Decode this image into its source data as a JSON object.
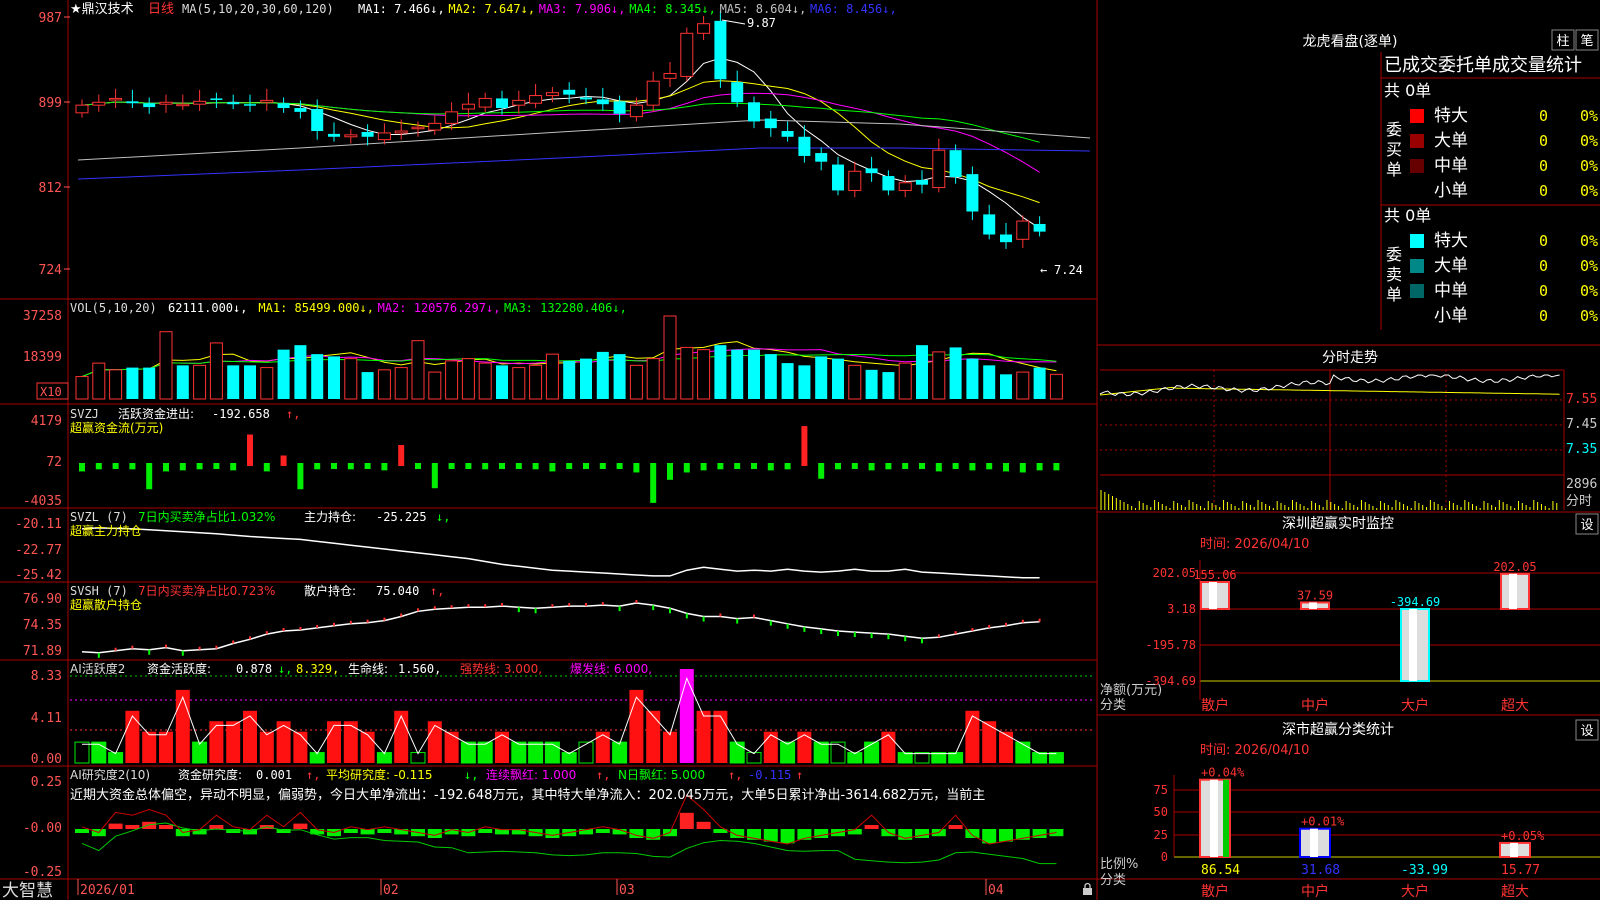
{
  "app": {
    "brand": "大智慧"
  },
  "main": {
    "stock_name": "★鼎汉技术",
    "period": "日线",
    "ma_header": "MA(5,10,20,30,60,120)",
    "ma_values": [
      {
        "label": "MA1:",
        "value": "7.466",
        "arrow": "↓",
        "color": "#ffffff"
      },
      {
        "label": "MA2:",
        "value": "7.647",
        "arrow": "↓",
        "color": "#ffff00"
      },
      {
        "label": "MA3:",
        "value": "7.906",
        "arrow": "↓",
        "color": "#ff00ff"
      },
      {
        "label": "MA4:",
        "value": "8.345",
        "arrow": "↓",
        "color": "#00ff00"
      },
      {
        "label": "MA5:",
        "value": "8.604",
        "arrow": "↓",
        "color": "#c0c0c0"
      },
      {
        "label": "MA6:",
        "value": "8.456",
        "arrow": "↓",
        "color": "#3333ff"
      }
    ],
    "y_ticks": [
      "987",
      "899",
      "812",
      "724"
    ],
    "high_label": "9.87",
    "low_label": "7.24"
  },
  "vol": {
    "header": "VOL(5,10,20)",
    "values": [
      {
        "label": "",
        "value": "62111.000",
        "arrow": "↓",
        "color": "#ffffff"
      },
      {
        "label": "MA1:",
        "value": "85499.000",
        "arrow": "↓",
        "color": "#ffff00"
      },
      {
        "label": "MA2:",
        "value": "120576.297",
        "arrow": "↓",
        "color": "#ff00ff"
      },
      {
        "label": "MA3:",
        "value": "132280.406",
        "arrow": "↓",
        "color": "#00ff00"
      }
    ],
    "y_ticks": [
      "37258",
      "18399"
    ],
    "unit": "X10"
  },
  "svzj": {
    "header": "SVZJ",
    "line1_label": "活跃资金进出:",
    "line1_value": "-192.658",
    "line1_arrow": "↑,",
    "line2": "超赢资金流(万元)",
    "y_ticks": [
      "4179",
      "72",
      "-4035"
    ]
  },
  "svzl": {
    "header": "SVZL (7)",
    "highlight": "7日内买卖净占比1.032%",
    "label": "主力持仓:",
    "value": "-25.225",
    "arrow": "↓,",
    "line2": "超赢主力持仓",
    "y_ticks": [
      "-20.11",
      "-22.77",
      "-25.42"
    ]
  },
  "svsh": {
    "header": "SVSH (7)",
    "highlight": "7日内买卖净占比0.723%",
    "label": "散户持仓:",
    "value": "75.040",
    "arrow": "↑,",
    "line2": "超赢散户持仓",
    "y_ticks": [
      "76.90",
      "74.35",
      "71.89"
    ]
  },
  "ai_active": {
    "header": "AI活跃度2",
    "label": "资金活跃度:",
    "value": "0.878",
    "arrow": "↓,",
    "v2": "8.329,",
    "life_label": "生命线:",
    "life_value": "1.560,",
    "strong": "强势线: 3.000,",
    "burst": "爆发线: 6.000,",
    "y_ticks": [
      "8.33",
      "4.11",
      "0.00"
    ]
  },
  "ai_research": {
    "header": "AI研究度2(10)",
    "label": "资金研究度:",
    "value": "0.001",
    "arrow": "↑,",
    "avg": "平均研究度: -0.115",
    "avg_arrow": "↓,",
    "cont": "连续飘红: 1.000",
    "cont_arrow": "↑,",
    "n": "N日飘红: 5.000",
    "n_arrow": "↑,",
    "last": "-0.115",
    "last_arrow": "↑",
    "summary": "近期大资金总体偏空，异动不明显，偏弱势，今日大单净流出：-192.648万元，其中特大单净流入：202.045万元，大单5日累计净出-3614.682万元，当前主",
    "y_ticks": [
      "0.25",
      "-0.00",
      "-0.25"
    ]
  },
  "x_axis": [
    "2026/01",
    "02",
    "03",
    "04"
  ],
  "right": {
    "title": "龙虎看盘(逐单)",
    "btn1": "柱",
    "btn2": "笔",
    "stat_title": "已成交委托单成交量统计",
    "buy": {
      "vlabel": "委买单",
      "total": "共 0单",
      "rows": [
        {
          "name": "特大",
          "qty": "0",
          "pct": "0%",
          "color": "#ff0000"
        },
        {
          "name": "大单",
          "qty": "0",
          "pct": "0%",
          "color": "#990000"
        },
        {
          "name": "中单",
          "qty": "0",
          "pct": "0%",
          "color": "#660000"
        },
        {
          "name": "小单",
          "qty": "0",
          "pct": "0%",
          "color": ""
        }
      ]
    },
    "sell": {
      "vlabel": "委卖单",
      "total": "共 0单",
      "rows": [
        {
          "name": "特大",
          "qty": "0",
          "pct": "0%",
          "color": "#00ffff"
        },
        {
          "name": "大单",
          "qty": "0",
          "pct": "0%",
          "color": "#008888"
        },
        {
          "name": "中单",
          "qty": "0",
          "pct": "0%",
          "color": "#006666"
        },
        {
          "name": "小单",
          "qty": "0",
          "pct": "0%",
          "color": ""
        }
      ]
    },
    "intraday_title": "分时走势",
    "intraday_y": [
      "7.55",
      "7.45",
      "7.35"
    ],
    "intraday_vol": "2896",
    "intraday_unit": "分时",
    "sz_title": "深圳超赢实时监控",
    "sz_btn": "设",
    "sz_time": "时间: 2026/04/10",
    "sz_y": [
      "202.05",
      "3.18",
      "-195.78",
      "-394.69"
    ],
    "sz_ylabel": "净额(万元)",
    "sz_xlabel": "分类",
    "sz_cats": [
      "散户",
      "中户",
      "大户",
      "超大"
    ],
    "sz_vals": [
      "155.06",
      "37.59",
      "-394.69",
      "202.05"
    ],
    "ss_title": "深市超赢分类统计",
    "ss_btn": "设",
    "ss_time": "时间: 2026/04/10",
    "ss_y": [
      "75",
      "50",
      "25",
      "0"
    ],
    "ss_ylabel": "比例%",
    "ss_xlabel": "分类",
    "ss_cats": [
      "散户",
      "中户",
      "大户",
      "超大"
    ],
    "ss_top": [
      "+0.04%",
      "+0.01%",
      "",
      "+0.05%"
    ],
    "ss_vals": [
      "86.54",
      "31.68",
      "-33.99",
      "15.77"
    ]
  },
  "chart_data": [
    {
      "type": "candlestick",
      "title": "★鼎汉技术 日线",
      "y_range": [
        7.24,
        9.87
      ],
      "high": 9.87,
      "low": 7.24,
      "close_series": [
        8.95,
        8.98,
        9.02,
        8.97,
        8.93,
        8.98,
        8.96,
        8.99,
        9.01,
        8.96,
        8.95,
        9.0,
        8.92,
        8.88,
        8.68,
        8.62,
        8.64,
        8.62,
        8.66,
        8.68,
        8.72,
        8.76,
        8.88,
        8.96,
        9.02,
        8.92,
        9.0,
        9.05,
        9.08,
        9.06,
        9.01,
        8.96,
        8.86,
        8.95,
        9.2,
        9.28,
        9.7,
        9.8,
        9.22,
        8.98,
        8.78,
        8.71,
        8.62,
        8.42,
        8.36,
        8.06,
        8.26,
        8.24,
        8.06,
        8.14,
        8.12,
        8.48,
        8.2,
        7.84,
        7.6,
        7.52,
        7.74,
        7.63
      ]
    },
    {
      "type": "bar",
      "title": "VOL(5,10,20)",
      "y_ticks": [
        37258,
        18399
      ],
      "unit": "X10",
      "values": [
        10,
        16,
        13,
        14,
        14,
        30,
        15,
        15,
        25,
        15,
        15,
        14,
        22,
        24,
        20,
        19,
        18,
        12,
        13,
        14,
        26,
        12,
        17,
        18,
        16,
        15,
        14,
        15,
        20,
        17,
        18,
        21,
        20,
        15,
        18,
        37,
        23,
        22,
        24,
        22,
        22,
        20,
        16,
        15,
        19,
        18,
        15,
        13,
        12,
        16,
        24,
        21,
        23,
        18,
        15,
        11,
        12,
        14,
        11
      ]
    },
    {
      "type": "bar",
      "title": "SVZJ 超赢资金流(万元)",
      "y_ticks": [
        4179,
        72,
        -4035
      ],
      "values": [
        -800,
        -600,
        -500,
        -600,
        -2500,
        -800,
        -700,
        -600,
        -500,
        -700,
        3000,
        -800,
        1000,
        -2500,
        -600,
        -500,
        -600,
        -400,
        -700,
        2000,
        -300,
        -2400,
        -300,
        -500,
        -600,
        -400,
        -500,
        -600,
        -800,
        -200,
        -300,
        -300,
        -400,
        -900,
        -3800,
        -1600,
        -900,
        -700,
        -600,
        -500,
        -400,
        -700,
        -600,
        3800,
        -1500,
        -600,
        -500,
        -700,
        -600,
        -400,
        -500,
        -800,
        -400,
        -700,
        -600,
        -800,
        -900,
        -700,
        -700
      ]
    },
    {
      "type": "line",
      "title": "SVZL 超赢主力持仓",
      "y_ticks": [
        -20.11,
        -22.77,
        -25.42
      ],
      "values": [
        -20.2,
        -20.1,
        -20.15,
        -20.2,
        -20.3,
        -20.4,
        -20.5,
        -20.6,
        -20.7,
        -20.85,
        -21.0,
        -21.1,
        -21.2,
        -21.3,
        -21.5,
        -21.7,
        -21.9,
        -22.1,
        -22.3,
        -22.5,
        -22.7,
        -22.9,
        -23.1,
        -23.3,
        -23.6,
        -23.9,
        -24.1,
        -24.3,
        -24.5,
        -24.6,
        -24.7,
        -24.8,
        -24.9,
        -25.0,
        -25.1,
        -25.1,
        -24.5,
        -24.2,
        -24.4,
        -24.6,
        -24.5,
        -24.6,
        -24.4,
        -24.6,
        -24.7,
        -24.6,
        -24.4,
        -24.6,
        -24.6,
        -24.4,
        -24.7,
        -24.8,
        -24.9,
        -25.0,
        -25.1,
        -25.2,
        -25.3,
        -25.3
      ]
    },
    {
      "type": "line",
      "title": "SVSH 超赢散户持仓",
      "y_ticks": [
        76.9,
        74.35,
        71.89
      ],
      "values": [
        72.2,
        72.1,
        72.3,
        72.5,
        72.4,
        72.6,
        72.3,
        72.4,
        72.5,
        73.0,
        73.4,
        73.9,
        74.2,
        74.3,
        74.5,
        74.7,
        74.9,
        75.0,
        75.2,
        75.6,
        76.1,
        76.3,
        76.4,
        76.5,
        76.5,
        76.6,
        76.5,
        76.4,
        76.5,
        76.6,
        76.6,
        76.7,
        76.6,
        76.9,
        76.7,
        76.4,
        75.9,
        75.6,
        75.6,
        75.4,
        75.5,
        75.2,
        74.9,
        74.6,
        74.4,
        74.2,
        74.1,
        74.0,
        73.9,
        73.7,
        73.5,
        73.6,
        73.9,
        74.2,
        74.5,
        74.7,
        75.0,
        75.1
      ]
    },
    {
      "type": "bar",
      "title": "AI活跃度2",
      "y_ticks": [
        8.33,
        4.11,
        0.0
      ],
      "thresholds": {
        "life": 1.56,
        "strong": 3.0,
        "burst": 6.0
      },
      "values": [
        2,
        2,
        1,
        5,
        3,
        3,
        7,
        2,
        4,
        4,
        5,
        3,
        4,
        3,
        1,
        4,
        4,
        3,
        1,
        5,
        1,
        4,
        3,
        2,
        2,
        3,
        2,
        2,
        2,
        1,
        2,
        3,
        2,
        7,
        5,
        3,
        9,
        5,
        5,
        2,
        1,
        3,
        2,
        3,
        2,
        2,
        1,
        2,
        3,
        1,
        1,
        1,
        1,
        5,
        4,
        3,
        2,
        1,
        1
      ]
    },
    {
      "type": "bar",
      "title": "AI研究度2(10)",
      "y_ticks": [
        0.25,
        -0.0,
        -0.25
      ],
      "values": [
        -0.02,
        -0.04,
        0.03,
        0.02,
        0.04,
        0.02,
        -0.04,
        -0.03,
        0.02,
        -0.02,
        -0.03,
        0.02,
        -0.02,
        0.03,
        -0.03,
        -0.04,
        -0.02,
        -0.03,
        -0.02,
        -0.03,
        -0.04,
        -0.05,
        -0.03,
        -0.04,
        -0.02,
        -0.03,
        -0.03,
        -0.04,
        -0.05,
        -0.04,
        -0.03,
        -0.02,
        -0.03,
        -0.05,
        -0.06,
        -0.04,
        0.09,
        0.04,
        -0.02,
        -0.05,
        -0.06,
        -0.07,
        -0.08,
        -0.06,
        -0.05,
        -0.04,
        -0.03,
        0.02,
        -0.04,
        -0.06,
        -0.05,
        -0.04,
        0.02,
        -0.05,
        -0.08,
        -0.07,
        -0.06,
        -0.05,
        -0.04
      ]
    }
  ]
}
